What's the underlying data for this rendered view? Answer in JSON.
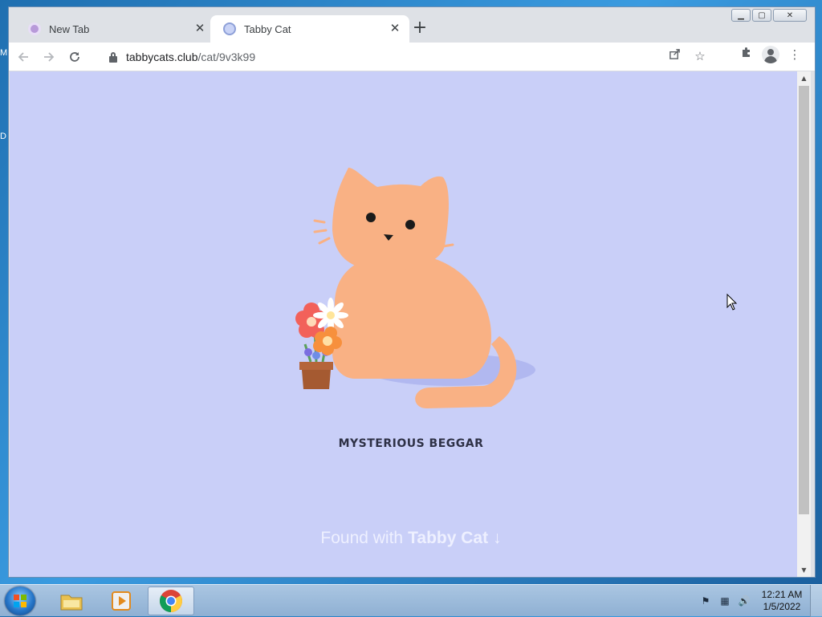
{
  "desktop": {
    "fragments": [
      "M",
      "D"
    ]
  },
  "browser": {
    "tabs": [
      {
        "title": "New Tab",
        "active": false
      },
      {
        "title": "Tabby Cat",
        "active": true
      }
    ],
    "new_tab_label": "+",
    "address": {
      "host": "tabbycats.club",
      "path": "/cat/9v3k99"
    },
    "colors": {
      "page_background": "#c9cff8",
      "cat": "#f9b184",
      "accent": "#2e3146"
    }
  },
  "page": {
    "cat_name": "MYSTERIOUS BEGGAR",
    "found_with": "Found with",
    "brand": "Tabby Cat",
    "arrow": "↓"
  },
  "taskbar": {
    "time": "12:21 AM",
    "date": "1/5/2022",
    "pinned": [
      "explorer-icon",
      "media-player-icon",
      "chrome-icon"
    ]
  }
}
